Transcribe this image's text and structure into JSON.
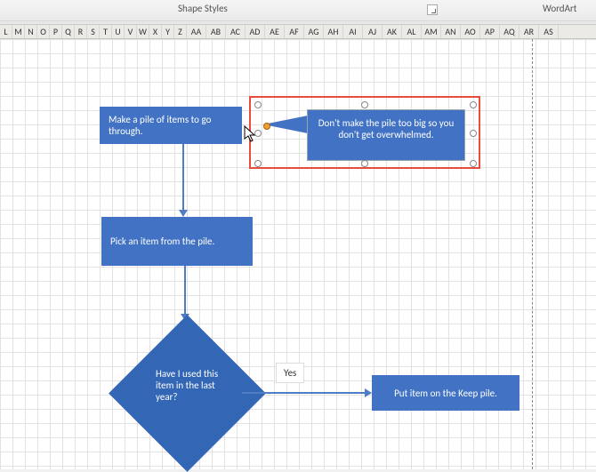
{
  "ribbon": {
    "shape_styles_label": "Shape Styles",
    "wordart_label": "WordArt"
  },
  "columns": [
    "L",
    "M",
    "N",
    "O",
    "P",
    "Q",
    "R",
    "S",
    "T",
    "U",
    "V",
    "W",
    "X",
    "Y",
    "Z",
    "AA",
    "AB",
    "AC",
    "AD",
    "AE",
    "AF",
    "AG",
    "AH",
    "AI",
    "AJ",
    "AK",
    "AL",
    "AM",
    "AN",
    "AO",
    "AP",
    "AQ",
    "AR",
    "AS"
  ],
  "column_widths": {
    "narrow": 14,
    "double": 22
  },
  "flow": {
    "step1": "Make a pile of items to go through.",
    "step2": "Pick an item from the pile.",
    "decision": "Have I used this item in the last year?",
    "yes_label": "Yes",
    "keep": "Put item on the Keep pile."
  },
  "callout": {
    "text": "Don't make the pile too big so you don't get overwhelmed."
  },
  "colors": {
    "shape_fill": "#4272c3",
    "diamond_fill": "#3366b5",
    "arrow": "#4f7dc4",
    "selection": "#e74c3c"
  }
}
